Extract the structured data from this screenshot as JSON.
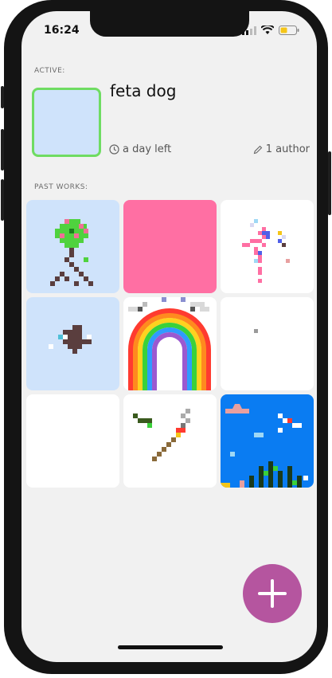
{
  "status": {
    "time": "16:24"
  },
  "active": {
    "section_label": "ACTIVE:",
    "title": "feta dog",
    "time_left": "a day left",
    "authors": "1 author"
  },
  "past": {
    "section_label": "PAST WORKS:",
    "tiles": [
      {
        "label": "tree",
        "bg": "#cfe3fb"
      },
      {
        "label": "pink",
        "bg": "#ff6fa3"
      },
      {
        "label": "splash",
        "bg": "#ffffff"
      },
      {
        "label": "bird",
        "bg": "#cfe3fb"
      },
      {
        "label": "rainbow",
        "bg": "#ffffff"
      },
      {
        "label": "dot",
        "bg": "#ffffff"
      },
      {
        "label": "blank",
        "bg": "#ffffff"
      },
      {
        "label": "torch",
        "bg": "#ffffff"
      },
      {
        "label": "ocean",
        "bg": "#0a7cf2"
      }
    ]
  },
  "colors": {
    "fab": "#b5559f",
    "active_border": "#6fdc62"
  }
}
